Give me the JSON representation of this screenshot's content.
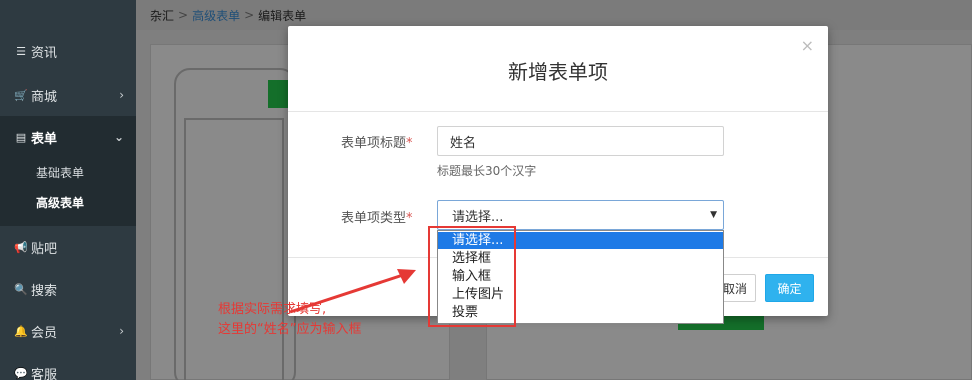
{
  "sidebar": {
    "items": [
      {
        "label": "资讯",
        "icon": "list-icon"
      },
      {
        "label": "商城",
        "icon": "cart-icon"
      },
      {
        "label": "表单",
        "icon": "form-icon"
      },
      {
        "label": "贴吧",
        "icon": "megaphone-icon"
      },
      {
        "label": "搜索",
        "icon": "search-icon"
      },
      {
        "label": "会员",
        "icon": "bell-icon"
      },
      {
        "label": "客服",
        "icon": "chat-icon"
      }
    ],
    "subitems": [
      {
        "label": "基础表单"
      },
      {
        "label": "高级表单"
      }
    ]
  },
  "breadcrumb": {
    "items": [
      "杂汇",
      "高级表单",
      "编辑表单"
    ]
  },
  "modal": {
    "title": "新增表单项",
    "close_glyph": "×",
    "title_label": "表单项标题",
    "required_mark": "*",
    "title_value": "姓名",
    "title_help": "标题最长30个汉字",
    "type_label": "表单项类型",
    "select_value": "请选择...",
    "options": [
      "请选择...",
      "选择框",
      "输入框",
      "上传图片",
      "投票"
    ],
    "cancel_label": "取消",
    "ok_label": "确定"
  },
  "annotation": {
    "lines": [
      "根据实际需求填写,",
      "这里的“姓名”应为输入框"
    ]
  },
  "colors": {
    "annotation": "#e53935",
    "accent": "#2fb2ee",
    "highlight": "#1e7ae6",
    "sidebar": "#2e3a41"
  }
}
